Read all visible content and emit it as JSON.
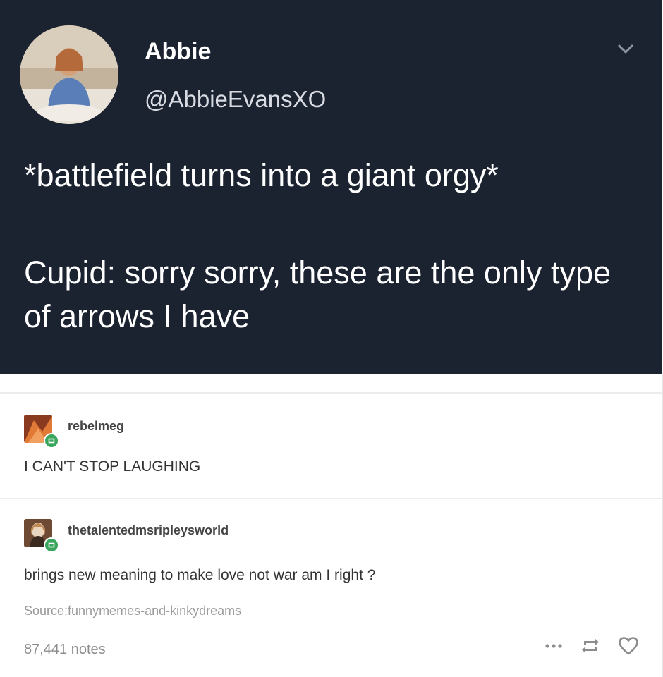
{
  "post": {
    "author_name": "Abbie",
    "author_handle": "@AbbieEvansXO",
    "paragraphs": [
      "*battlefield turns into a giant orgy*",
      "Cupid: sorry sorry, these are the only type of arrows I have"
    ]
  },
  "reblogs": [
    {
      "username": "rebelmeg",
      "text": "I CAN'T STOP LAUGHING"
    },
    {
      "username": "thetalentedmsripleysworld",
      "text": "brings new meaning to make love not war am I right ?"
    }
  ],
  "source": "Source:funnymemes-and-kinkydreams",
  "notes": "87,441 notes",
  "icons": {
    "chevron": "chevron-down-icon",
    "more": "more-options-icon",
    "reblog": "reblog-icon",
    "like": "heart-icon"
  },
  "colors": {
    "tweet_background": "#1b2230",
    "reblog_badge": "#3aa55c"
  }
}
